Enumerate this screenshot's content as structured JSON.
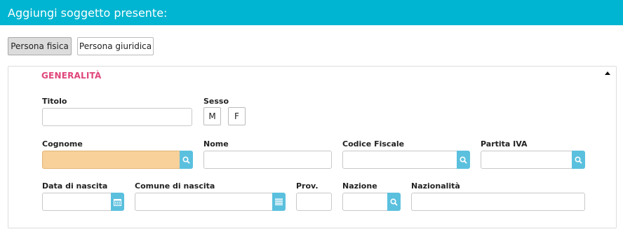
{
  "header": {
    "title": "Aggiungi soggetto presente:"
  },
  "type_toggle": {
    "physical": "Persona fisica",
    "legal": "Persona giuridica"
  },
  "section": {
    "title": "GENERALITÀ"
  },
  "fields": {
    "titolo": {
      "label": "Titolo",
      "value": ""
    },
    "sesso": {
      "label": "Sesso",
      "male": "M",
      "female": "F"
    },
    "cognome": {
      "label": "Cognome",
      "value": ""
    },
    "nome": {
      "label": "Nome",
      "value": ""
    },
    "codice_fiscale": {
      "label": "Codice Fiscale",
      "value": ""
    },
    "partita_iva": {
      "label": "Partita IVA",
      "value": ""
    },
    "data_nascita": {
      "label": "Data di nascita",
      "value": ""
    },
    "comune_nascita": {
      "label": "Comune di nascita",
      "value": ""
    },
    "prov": {
      "label": "Prov.",
      "value": ""
    },
    "nazione": {
      "label": "Nazione",
      "value": ""
    },
    "nazionalita": {
      "label": "Nazionalità",
      "value": ""
    }
  },
  "icons": {
    "search": "search-icon",
    "calendar": "calendar-icon",
    "list": "list-icon",
    "collapse": "collapse-icon"
  },
  "colors": {
    "header": "#00b5d1",
    "accent": "#e0457b",
    "addon": "#5bc0de",
    "highlight": "#f7d09a"
  }
}
